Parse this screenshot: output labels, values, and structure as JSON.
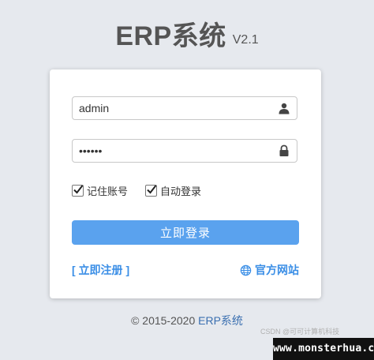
{
  "header": {
    "title": "ERP系统",
    "version": "V2.1"
  },
  "form": {
    "username_value": "admin",
    "password_value": "••••••",
    "remember_account_label": "记住账号",
    "remember_account_checked": true,
    "auto_login_label": "自动登录",
    "auto_login_checked": true,
    "login_button_label": "立即登录",
    "register_link_label": "[ 立即注册 ]",
    "website_link_label": "官方网站"
  },
  "footer": {
    "copyright": "© 2015-2020",
    "brand": "ERP系统"
  },
  "overlay": {
    "csdn_text": "CSDN @可可计算机科技",
    "watermark_text": "www.monsterhua.com"
  },
  "colors": {
    "background": "#e6e9ee",
    "accent": "#5aa2ee",
    "link": "#3a8ee6"
  },
  "icons": {
    "username": "user-icon",
    "password": "lock-icon",
    "website": "globe-icon",
    "checkbox": "checkmark-icon"
  }
}
